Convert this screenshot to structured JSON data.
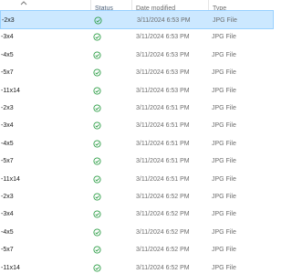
{
  "columns": {
    "name_sort_indicator": "chevron-up-icon",
    "status": "Status",
    "date_modified": "Date modified",
    "type": "Type"
  },
  "colors": {
    "selection_bg": "#cce8ff",
    "selection_border": "#99d1ff",
    "status_green": "#2e9e47"
  },
  "files": [
    {
      "name": "-2x3",
      "status_icon": "synced-check-icon",
      "date": "3/11/2024 6:53 PM",
      "type": "JPG File",
      "selected": true
    },
    {
      "name": "-3x4",
      "status_icon": "synced-check-icon",
      "date": "3/11/2024 6:53 PM",
      "type": "JPG File",
      "selected": false
    },
    {
      "name": "-4x5",
      "status_icon": "synced-check-icon",
      "date": "3/11/2024 6:53 PM",
      "type": "JPG File",
      "selected": false
    },
    {
      "name": "-5x7",
      "status_icon": "synced-check-icon",
      "date": "3/11/2024 6:53 PM",
      "type": "JPG File",
      "selected": false
    },
    {
      "name": "-11x14",
      "status_icon": "synced-check-icon",
      "date": "3/11/2024 6:53 PM",
      "type": "JPG File",
      "selected": false
    },
    {
      "name": "-2x3",
      "status_icon": "synced-check-icon",
      "date": "3/11/2024 6:51 PM",
      "type": "JPG File",
      "selected": false
    },
    {
      "name": "-3x4",
      "status_icon": "synced-check-icon",
      "date": "3/11/2024 6:51 PM",
      "type": "JPG File",
      "selected": false
    },
    {
      "name": "-4x5",
      "status_icon": "synced-check-icon",
      "date": "3/11/2024 6:51 PM",
      "type": "JPG File",
      "selected": false
    },
    {
      "name": "-5x7",
      "status_icon": "synced-check-icon",
      "date": "3/11/2024 6:51 PM",
      "type": "JPG File",
      "selected": false
    },
    {
      "name": "-11x14",
      "status_icon": "synced-check-icon",
      "date": "3/11/2024 6:51 PM",
      "type": "JPG File",
      "selected": false
    },
    {
      "name": "-2x3",
      "status_icon": "synced-check-icon",
      "date": "3/11/2024 6:52 PM",
      "type": "JPG File",
      "selected": false
    },
    {
      "name": "-3x4",
      "status_icon": "synced-check-icon",
      "date": "3/11/2024 6:52 PM",
      "type": "JPG File",
      "selected": false
    },
    {
      "name": "-4x5",
      "status_icon": "synced-check-icon",
      "date": "3/11/2024 6:52 PM",
      "type": "JPG File",
      "selected": false
    },
    {
      "name": "-5x7",
      "status_icon": "synced-check-icon",
      "date": "3/11/2024 6:52 PM",
      "type": "JPG File",
      "selected": false
    },
    {
      "name": "-11x14",
      "status_icon": "synced-check-icon",
      "date": "3/11/2024 6:52 PM",
      "type": "JPG File",
      "selected": false
    }
  ]
}
